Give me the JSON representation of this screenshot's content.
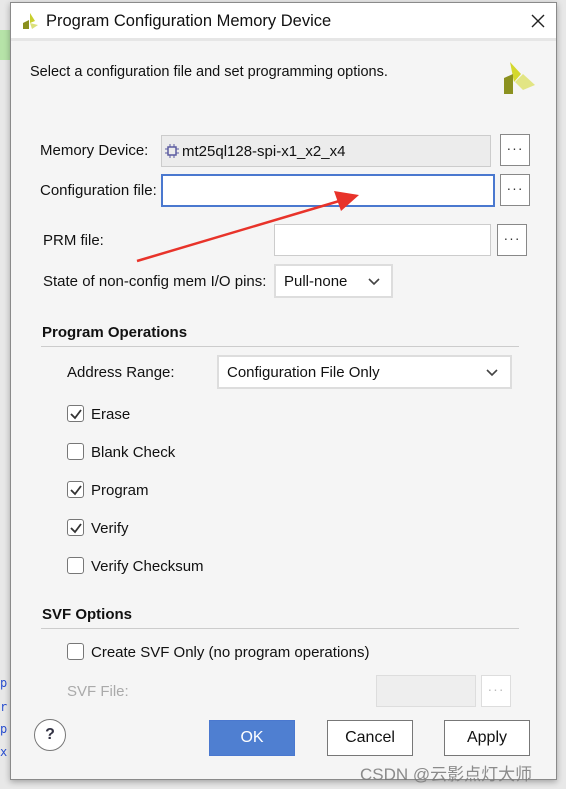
{
  "dialog": {
    "title": "Program Configuration Memory Device",
    "description": "Select a configuration file and set programming options.",
    "memory_device": {
      "label": "Memory Device:",
      "value": "mt25ql128-spi-x1_x2_x4",
      "browse": "···"
    },
    "configuration_file": {
      "label": "Configuration file:",
      "value": "",
      "browse": "···"
    },
    "prm_file": {
      "label": "PRM file:",
      "value": "",
      "browse": "···"
    },
    "io_pins": {
      "label": "State of non-config mem I/O pins:",
      "value": "Pull-none"
    },
    "program_operations": {
      "title": "Program Operations",
      "address_range": {
        "label": "Address Range:",
        "value": "Configuration File Only"
      },
      "options": [
        {
          "label": "Erase",
          "checked": true
        },
        {
          "label": "Blank Check",
          "checked": false
        },
        {
          "label": "Program",
          "checked": true
        },
        {
          "label": "Verify",
          "checked": true
        },
        {
          "label": "Verify Checksum",
          "checked": false
        }
      ]
    },
    "svf_options": {
      "title": "SVF Options",
      "create_svf_only": {
        "label": "Create SVF Only (no program operations)",
        "checked": false
      },
      "svf_file": {
        "label": "SVF File:",
        "value": "",
        "browse": "···"
      }
    },
    "buttons": {
      "help": "?",
      "ok": "OK",
      "cancel": "Cancel",
      "apply": "Apply"
    }
  },
  "watermark": "CSDN @云影点灯大师",
  "colors": {
    "accent": "#4f7fd1",
    "focus_border": "#4a78cf",
    "annotation_arrow": "#e8332a"
  }
}
